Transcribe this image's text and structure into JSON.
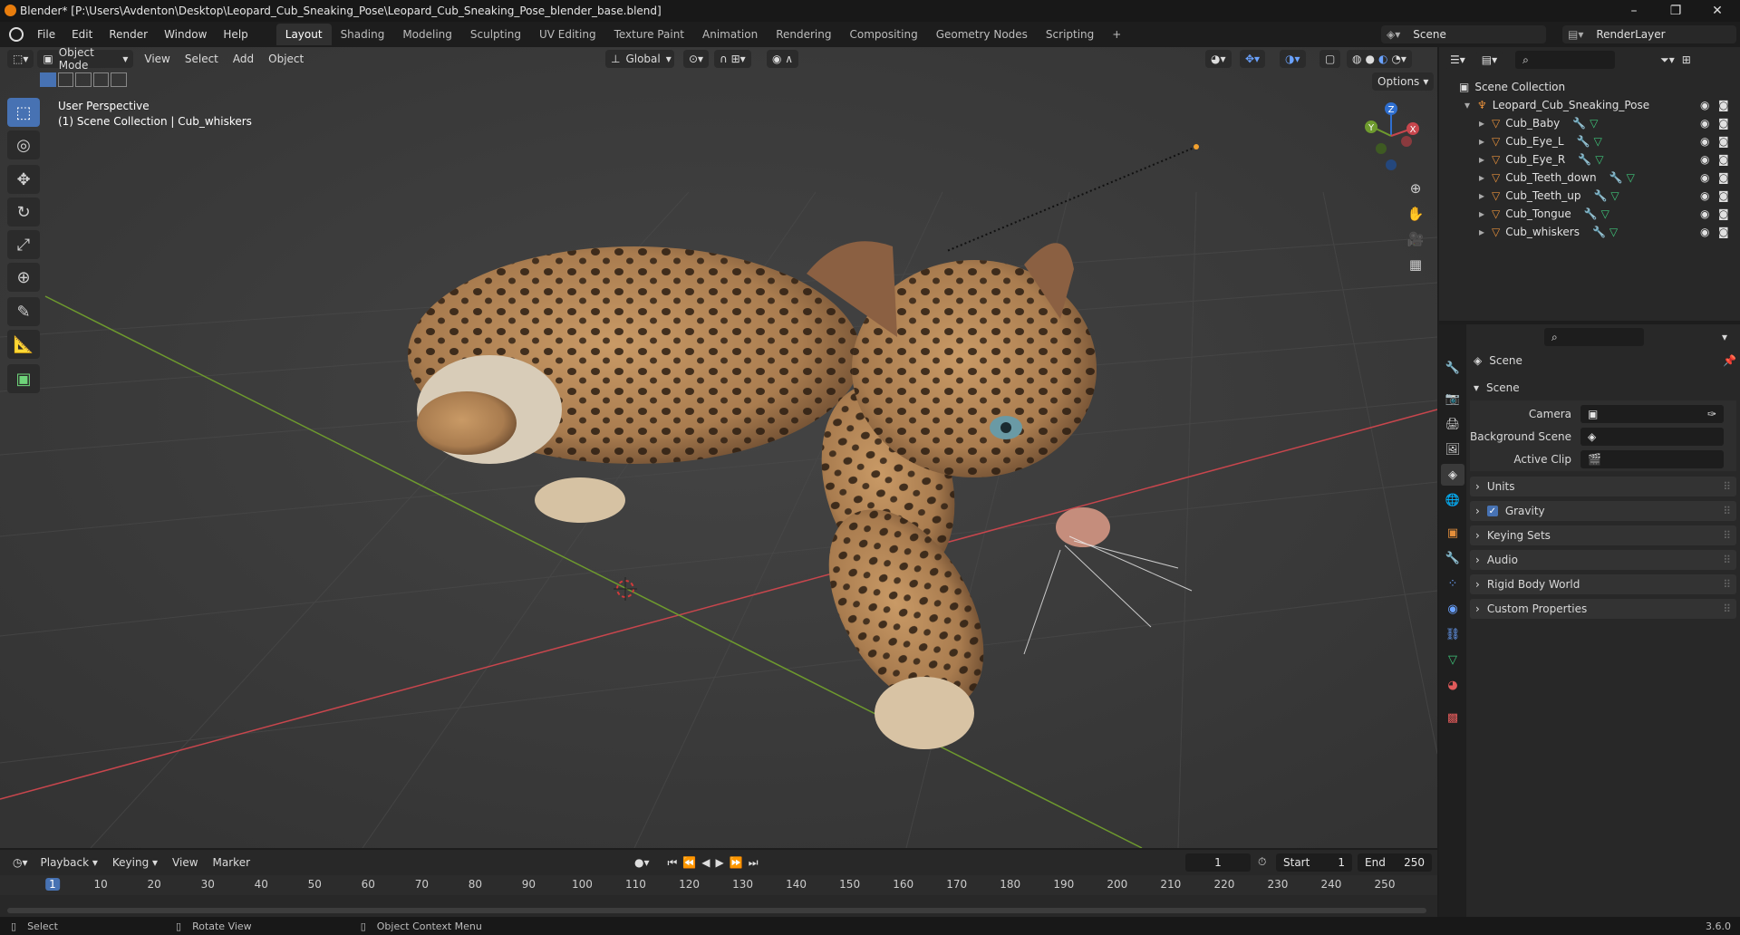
{
  "window": {
    "title": "Blender* [P:\\Users\\Avdenton\\Desktop\\Leopard_Cub_Sneaking_Pose\\Leopard_Cub_Sneaking_Pose_blender_base.blend]",
    "minimize": "–",
    "maximize": "❐",
    "close": "✕"
  },
  "menu": {
    "items": [
      "File",
      "Edit",
      "Render",
      "Window",
      "Help"
    ],
    "workspaces": [
      "Layout",
      "Shading",
      "Modeling",
      "Sculpting",
      "UV Editing",
      "Texture Paint",
      "Animation",
      "Rendering",
      "Compositing",
      "Geometry Nodes",
      "Scripting"
    ],
    "add_tab": "+",
    "scene": "Scene",
    "view_layer": "RenderLayer"
  },
  "viewport_header": {
    "mode": "Object Mode",
    "menus": [
      "View",
      "Select",
      "Add",
      "Object"
    ],
    "orientation": "Global",
    "options": "Options"
  },
  "viewport": {
    "perspective": "User Perspective",
    "collection_info": "(1) Scene Collection | Cub_whiskers",
    "gizmo_axes": [
      "Z",
      "Y",
      "X"
    ]
  },
  "outliner": {
    "root": "Scene Collection",
    "collection": "Leopard_Cub_Sneaking_Pose",
    "objects": [
      "Cub_Baby",
      "Cub_Eye_L",
      "Cub_Eye_R",
      "Cub_Teeth_down",
      "Cub_Teeth_up",
      "Cub_Tongue",
      "Cub_whiskers"
    ]
  },
  "properties": {
    "context": "Scene",
    "panel": "Scene",
    "fields": [
      {
        "label": "Camera"
      },
      {
        "label": "Background Scene"
      },
      {
        "label": "Active Clip"
      }
    ],
    "subpanels": [
      "Units",
      "Gravity",
      "Keying Sets",
      "Audio",
      "Rigid Body World",
      "Custom Properties"
    ]
  },
  "timeline": {
    "menus": [
      "Playback",
      "Keying",
      "View",
      "Marker"
    ],
    "current_frame": "1",
    "start_label": "Start",
    "start": "1",
    "end_label": "End",
    "end": "250",
    "ticks": [
      "1",
      "10",
      "20",
      "30",
      "40",
      "50",
      "60",
      "70",
      "80",
      "90",
      "100",
      "110",
      "120",
      "130",
      "140",
      "150",
      "160",
      "170",
      "180",
      "190",
      "200",
      "210",
      "220",
      "230",
      "240",
      "250"
    ]
  },
  "statusbar": {
    "select": "Select",
    "rotate": "Rotate View",
    "context_menu": "Object Context Menu",
    "version": "3.6.0"
  },
  "colors": {
    "accent": "#4772b3",
    "x_axis": "#c8464d",
    "y_axis": "#6e9a2e",
    "z_axis": "#2f6fd0",
    "mesh_icon": "#e58f3b",
    "modifier_icon": "#6aa2ff",
    "data_icon": "#3fc57a"
  }
}
